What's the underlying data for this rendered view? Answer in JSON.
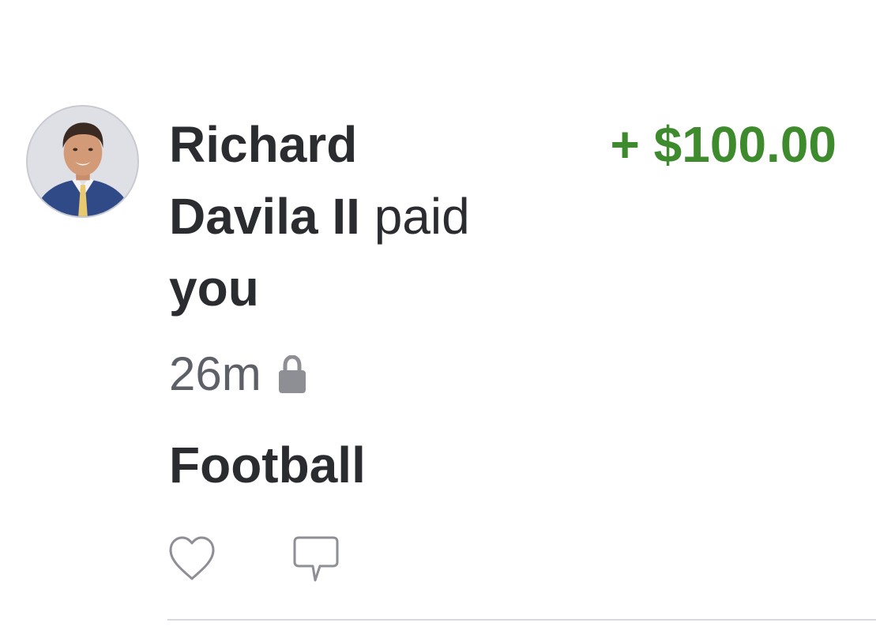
{
  "story": {
    "actor_line1": "Richard",
    "actor_line2": "Davila II",
    "action": "paid",
    "target": "you",
    "amount": "+ $100.00",
    "time": "26m",
    "note": "Football",
    "privacy_icon": "lock-icon",
    "avatar_icon": "profile-photo"
  },
  "actions": {
    "like_icon": "heart-icon",
    "comment_icon": "comment-icon"
  },
  "colors": {
    "amount_green": "#3d8b2c",
    "text_dark": "#2b2c30",
    "text_muted": "#5e6067",
    "icon_gray": "#8e8f95"
  }
}
